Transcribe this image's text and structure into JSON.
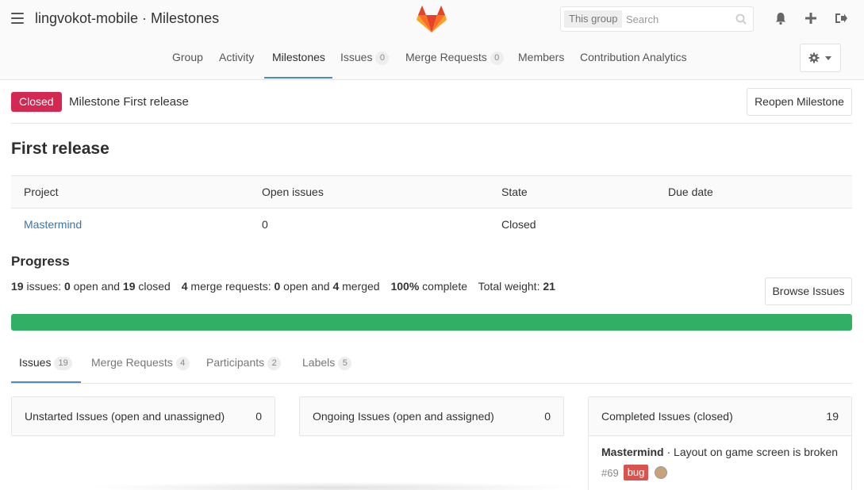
{
  "header": {
    "title": "lingvokot-mobile · Milestones",
    "search": {
      "scope": "This group",
      "placeholder": "Search"
    },
    "icons": [
      "menu-icon",
      "gitlab-logo",
      "search-icon",
      "bell-icon",
      "plus-icon",
      "sign-out-icon",
      "gear-icon",
      "caret-down-icon"
    ]
  },
  "nav": {
    "items": [
      {
        "label": "Group"
      },
      {
        "label": "Activity"
      },
      {
        "label": "Milestones"
      },
      {
        "label": "Issues",
        "count": "0"
      },
      {
        "label": "Merge Requests",
        "count": "0"
      },
      {
        "label": "Members"
      },
      {
        "label": "Contribution Analytics"
      }
    ],
    "active": "Milestones"
  },
  "milestone": {
    "status": "Closed",
    "reference": "Milestone First release",
    "reopen_label": "Reopen Milestone",
    "title": "First release"
  },
  "table": {
    "headers": [
      "Project",
      "Open issues",
      "State",
      "Due date"
    ],
    "rows": [
      {
        "project": "Mastermind",
        "open_issues": "0",
        "state": "Closed",
        "due_date": ""
      }
    ]
  },
  "progress": {
    "heading": "Progress",
    "issues_total": "19",
    "issues_open": "0",
    "issues_closed": "19",
    "mr_total": "4",
    "mr_open": "0",
    "mr_merged": "4",
    "percent_complete": "100%",
    "total_weight": "21",
    "fraction": 1.0,
    "browse_label": "Browse Issues"
  },
  "tabs": [
    {
      "label": "Issues",
      "count": "19"
    },
    {
      "label": "Merge Requests",
      "count": "4"
    },
    {
      "label": "Participants",
      "count": "2"
    },
    {
      "label": "Labels",
      "count": "5"
    }
  ],
  "panels": {
    "unstarted": {
      "title": "Unstarted Issues (open and unassigned)",
      "count": "0"
    },
    "ongoing": {
      "title": "Ongoing Issues (open and assigned)",
      "count": "0"
    },
    "completed": {
      "title": "Completed Issues (closed)",
      "count": "19",
      "issues": [
        {
          "project": "Mastermind",
          "title": "Layout on game screen is broken",
          "number": "#69",
          "label": "bug"
        }
      ]
    }
  },
  "colors": {
    "closed_badge": "#d22852",
    "progress_bar": "#31af64",
    "link": "#3777b0",
    "active_underline": "#4a8bc2",
    "bug_label": "#d9534f"
  }
}
